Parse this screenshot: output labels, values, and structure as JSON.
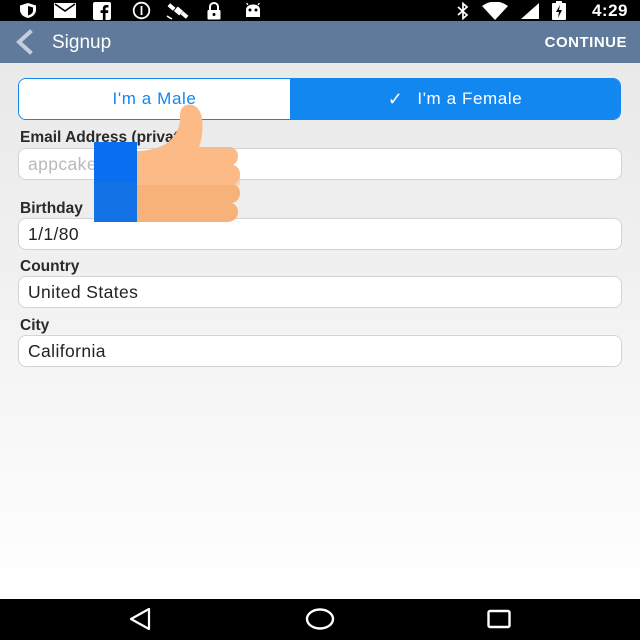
{
  "status_bar": {
    "time": "4:29",
    "icons": [
      "shield-icon",
      "mail-icon",
      "facebook-icon",
      "circle-info-icon",
      "satellite-icon",
      "lock-icon",
      "android-icon",
      "bluetooth-icon",
      "wifi-icon",
      "battery-icon"
    ]
  },
  "app_bar": {
    "title": "Signup",
    "action": "CONTINUE"
  },
  "gender": {
    "male_label": "I'm a Male",
    "female_label": "I'm a Female",
    "selected": "female",
    "check_glyph": "✓",
    "accent_color": "#1387f0"
  },
  "form": {
    "email_label": "Email Address (private)",
    "email_placeholder": "appcake@gmail.com",
    "birthday_label": "Birthday",
    "birthday_value": "1/1/80",
    "country_label": "Country",
    "country_value": "United States",
    "city_label": "City",
    "city_value": "California"
  },
  "nav_bar": {
    "buttons": [
      "back-triangle-icon",
      "home-circle-icon",
      "recents-square-icon"
    ]
  }
}
